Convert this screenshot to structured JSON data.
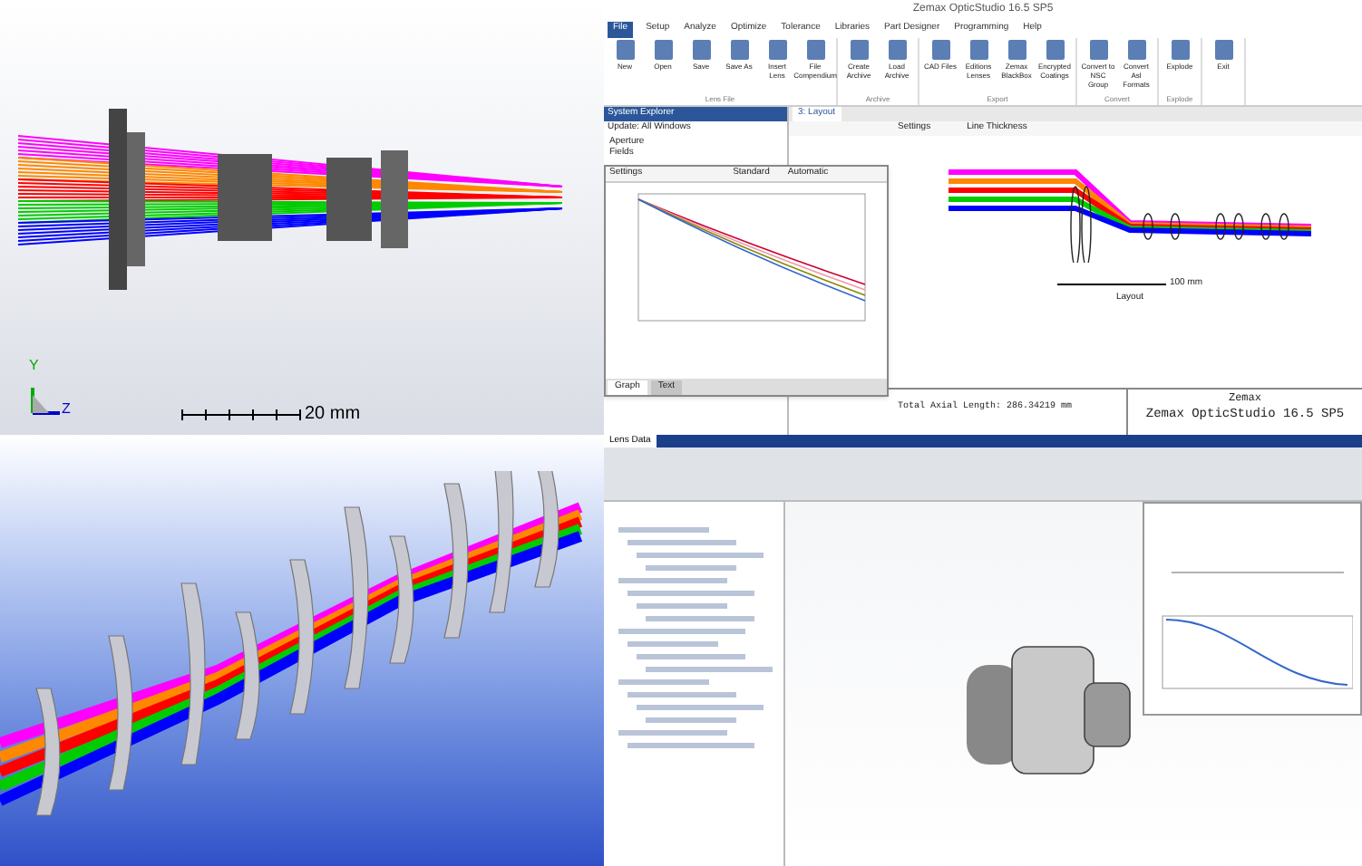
{
  "top_left": {
    "axis_labels": [
      "Y",
      "Z"
    ],
    "scale_label": "20 mm"
  },
  "zemax": {
    "title": "Zemax OpticStudio 16.5 SP5",
    "menu": [
      {
        "label": "File",
        "selected": true
      },
      {
        "label": "Setup",
        "selected": false
      },
      {
        "label": "Analyze",
        "selected": false
      },
      {
        "label": "Optimize",
        "selected": false
      },
      {
        "label": "Tolerance",
        "selected": false
      },
      {
        "label": "Libraries",
        "selected": false
      },
      {
        "label": "Part Designer",
        "selected": false
      },
      {
        "label": "Programming",
        "selected": false
      },
      {
        "label": "Help",
        "selected": false
      }
    ],
    "ribbon_groups": [
      {
        "label": "Lens File",
        "buttons": [
          "New",
          "Open",
          "Save",
          "Save As",
          "Insert Lens",
          "File Compendium"
        ]
      },
      {
        "label": "Archive",
        "buttons": [
          "Create Archive",
          "Load Archive"
        ]
      },
      {
        "label": "Export",
        "buttons": [
          "CAD Files",
          "Editions Lenses",
          "Zemax BlackBox",
          "Encrypted Coatings"
        ]
      },
      {
        "label": "Convert",
        "buttons": [
          "Convert to NSC Group",
          "Convert Asl Formats"
        ]
      },
      {
        "label": "Explode",
        "buttons": [
          "Explode"
        ]
      },
      {
        "buttons": [
          "Exit"
        ]
      }
    ],
    "system_explorer": {
      "title": "System Explorer",
      "update": "Update: All Windows",
      "items": [
        "Aperture",
        "Fields"
      ]
    },
    "mtf_window": {
      "toolbar": [
        "Settings",
        "Standard",
        "Automatic"
      ],
      "tabs": [
        {
          "label": "Graph",
          "selected": true
        },
        {
          "label": "Text",
          "selected": false
        }
      ]
    },
    "layout_window": {
      "tab": "3: Layout",
      "toolbar": [
        "Settings",
        "Line Thickness"
      ],
      "scale_label": "100 mm",
      "caption": "Layout"
    },
    "total_length": "Total Axial Length: 286.34219 mm",
    "info_box": {
      "company": "Zemax",
      "product": "Zemax OpticStudio 16.5 SP5"
    }
  },
  "cad": {
    "tab": "Lens Data"
  }
}
